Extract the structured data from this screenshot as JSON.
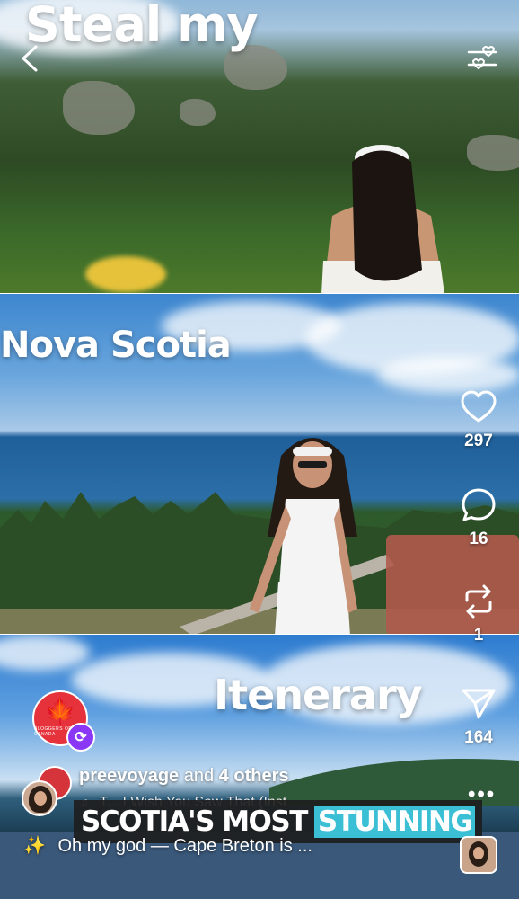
{
  "overlay_titles": {
    "line1": "Steal my",
    "line2": "Nova Scotia",
    "line3": "Itenerary"
  },
  "actions": {
    "likes": "297",
    "comments": "16",
    "reposts": "1",
    "shares": "164"
  },
  "account_badge": {
    "text": "BLOGGERS OF CANADA"
  },
  "post": {
    "author": "preevoyage",
    "and_text": "and",
    "others": "4 others",
    "audio": "T... I Wish You Saw That (Inst",
    "caption": "Oh my god — Cape Breton is ..."
  },
  "subtitle": {
    "text": "SCOTIA'S MOST",
    "highlight": "STUNNING"
  },
  "colors": {
    "highlight": "#3bbfd4",
    "badge_red": "#e5323b",
    "repost_purple": "#8a38f5"
  }
}
